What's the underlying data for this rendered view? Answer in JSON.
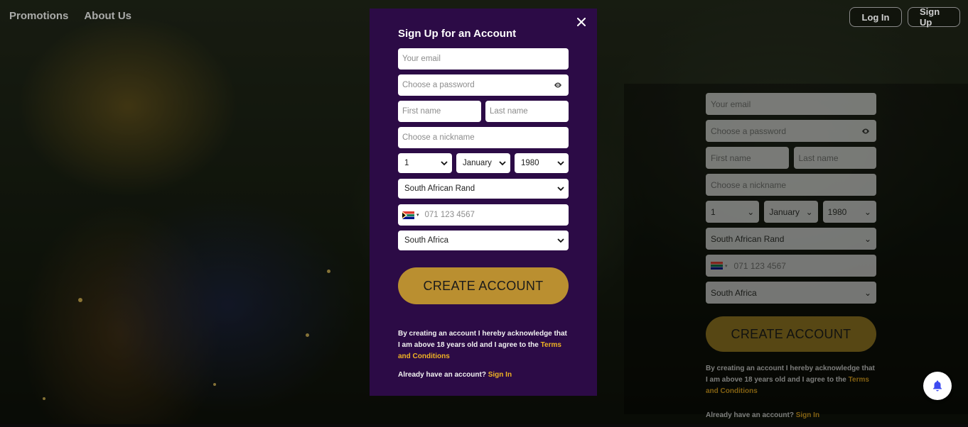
{
  "nav": {
    "promotions": "Promotions",
    "about_us": "About Us",
    "login": "Log In",
    "signup": "Sign Up"
  },
  "modal": {
    "title": "Sign Up for an Account",
    "close_icon": "close-icon",
    "email_placeholder": "Your email",
    "password_placeholder": "Choose a password",
    "first_name_placeholder": "First name",
    "last_name_placeholder": "Last name",
    "nickname_placeholder": "Choose a nickname",
    "dob_day": "1",
    "dob_month": "January",
    "dob_year": "1980",
    "currency": "South African Rand",
    "phone_placeholder": "071 123 4567",
    "country": "South Africa",
    "create_account": "CREATE ACCOUNT",
    "terms_prefix": "By creating an account I hereby acknowledge that I am above 18 years old and I agree to the ",
    "terms_link": "Terms and Conditions",
    "already": "Already have an account? ",
    "sign_in": "Sign In"
  },
  "background_form": {
    "email_placeholder": "Your email",
    "password_placeholder": "Choose a password",
    "first_name_placeholder": "First name",
    "last_name_placeholder": "Last name",
    "nickname_placeholder": "Choose a nickname",
    "dob_day": "1",
    "dob_month": "January",
    "dob_year": "1980",
    "currency": "South African Rand",
    "phone_placeholder": "071 123 4567",
    "country": "South Africa",
    "create_account": "CREATE ACCOUNT",
    "terms_prefix": "By creating an account I hereby acknowledge that I am above 18 years old and I agree to the ",
    "terms_link": "Terms and Conditions",
    "already": "Already have an account? ",
    "sign_in": "Sign In"
  },
  "colors": {
    "modal_bg": "#2c0b46",
    "cta": "#ba8f30",
    "link": "#f0b323"
  },
  "icons": {
    "eye": "eye-icon",
    "chevron": "chevron-down-icon",
    "bell": "bell-icon",
    "flag": "south-africa-flag-icon"
  }
}
